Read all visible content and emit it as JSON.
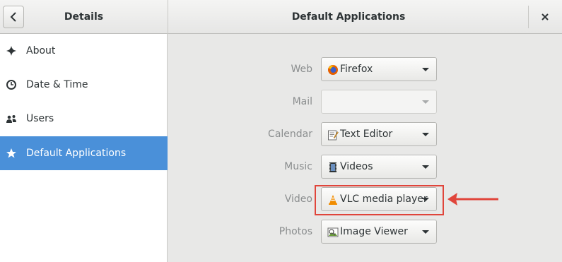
{
  "header": {
    "sidebar_title": "Details",
    "main_title": "Default Applications"
  },
  "sidebar": {
    "items": [
      {
        "label": "About",
        "icon": "star-sparkle-icon",
        "selected": false
      },
      {
        "label": "Date & Time",
        "icon": "clock-icon",
        "selected": false
      },
      {
        "label": "Users",
        "icon": "users-icon",
        "selected": false
      },
      {
        "label": "Default Applications",
        "icon": "star-icon",
        "selected": true
      }
    ]
  },
  "defaults": {
    "rows": [
      {
        "label": "Web",
        "app": "Firefox",
        "icon": "firefox-icon",
        "enabled": true
      },
      {
        "label": "Mail",
        "app": "",
        "icon": "",
        "enabled": false
      },
      {
        "label": "Calendar",
        "app": "Text Editor",
        "icon": "text-editor-icon",
        "enabled": true
      },
      {
        "label": "Music",
        "app": "Videos",
        "icon": "videos-icon",
        "enabled": true
      },
      {
        "label": "Video",
        "app": "VLC media player",
        "icon": "vlc-icon",
        "enabled": true
      },
      {
        "label": "Photos",
        "app": "Image Viewer",
        "icon": "image-viewer-icon",
        "enabled": true
      }
    ]
  },
  "colors": {
    "selection": "#4a90d9",
    "annotation": "#e0453b"
  }
}
